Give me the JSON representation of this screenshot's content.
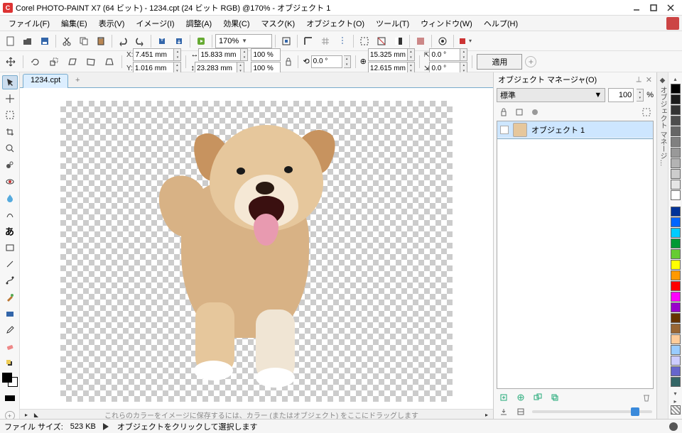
{
  "title": "Corel PHOTO-PAINT X7 (64 ビット) - 1234.cpt (24 ビット RGB) @170% - オブジェクト 1",
  "menu": [
    "ファイル(F)",
    "編集(E)",
    "表示(V)",
    "イメージ(I)",
    "調整(A)",
    "効果(C)",
    "マスク(K)",
    "オブジェクト(O)",
    "ツール(T)",
    "ウィンドウ(W)",
    "ヘルプ(H)"
  ],
  "zoom": "170%",
  "props": {
    "x": "7.451 mm",
    "y": "1.016 mm",
    "w": "15.833 mm",
    "h": "23.283 mm",
    "sx": "100 %",
    "sy": "100 %",
    "rot": "0.0 °",
    "cx": "15.325 mm",
    "cy": "12.615 mm",
    "skx": "0.0 °",
    "sky": "0.0 °",
    "apply": "適用"
  },
  "doc_tab": "1234.cpt",
  "panel": {
    "title": "オブジェクト マネージャ(O)",
    "blend": "標準",
    "opacity": "100",
    "pct": "%",
    "layer1": "オブジェクト 1"
  },
  "canvas_hint": "これらのカラーをイメージに保存するには、カラー (またはオブジェクト) をここにドラッグします",
  "status": {
    "filesize_label": "ファイル サイズ:",
    "filesize": "523 KB",
    "tip": "オブジェクトをクリックして選択します"
  },
  "palette_grays": [
    "#000000",
    "#1a1a1a",
    "#333333",
    "#4d4d4d",
    "#666666",
    "#808080",
    "#999999",
    "#b3b3b3",
    "#cccccc",
    "#e6e6e6",
    "#ffffff"
  ],
  "palette_colors": [
    "#003399",
    "#0066ff",
    "#00ccff",
    "#009933",
    "#66cc33",
    "#ffff00",
    "#ff9900",
    "#ff0000",
    "#ff00ff",
    "#9900cc",
    "#663300",
    "#996633",
    "#ffcc99",
    "#99ccff",
    "#ccccff",
    "#6666cc",
    "#336666"
  ]
}
